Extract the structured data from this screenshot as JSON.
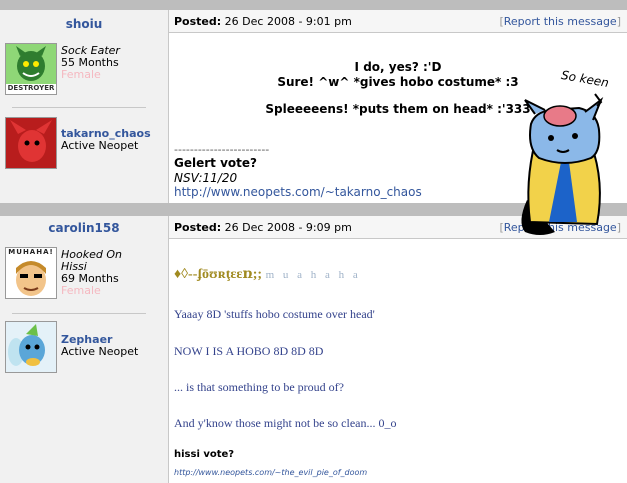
{
  "posts": [
    {
      "username": "shoiu",
      "user_title": "Sock Eater",
      "months": "55 Months",
      "gender": "Female",
      "avatar_badge": "DESTROYER",
      "pet_name": "takarno_chaos",
      "pet_status": "Active Neopet",
      "posted_label": "Posted:",
      "posted_date": "26 Dec 2008 - 9:01 pm",
      "report_label": "Report this message",
      "lines": [
        "I do, yes? :'D",
        "Sure! ^w^ *gives hobo costume* :3",
        "Spleeeeens! *puts them on head* :'333"
      ],
      "sig_dashes": "------------------------",
      "sig_title": "Gelert vote?",
      "sig_italic": "NSV:11/20",
      "sig_link": "http://www.neopets.com/~takarno_chaos"
    },
    {
      "username": "carolin158",
      "user_title_line1": "Hooked On",
      "user_title_line2": "Hissi",
      "months": "69 Months",
      "gender": "Female",
      "avatar_badge": "MUHAHA!",
      "pet_name": "Zephaer",
      "pet_status": "Active Neopet",
      "posted_label": "Posted:",
      "posted_date": "26 Dec 2008 - 9:09 pm",
      "report_label": "Report this message",
      "fourteen": "♦◊--ʄōʊʀţɛɛռ;;",
      "muhaha": "m u a h a h a",
      "lines": [
        "Yaaay 8D 'stuffs hobo costume over head'",
        "NOW I IS A HOBO 8D 8D 8D",
        "... is that something to be proud of?",
        "And y'know those might not be so clean... 0_o"
      ],
      "sig_title": "hissi vote?",
      "sig_link": "http://www.neopets.com/~the_evil_pie_of_doom"
    }
  ],
  "drawing_text": "So keen",
  "colors": {
    "link": "#33569c",
    "bar": "#bdbdbd",
    "sidebar": "#f1f1f1",
    "female": "#f5b8c0"
  }
}
